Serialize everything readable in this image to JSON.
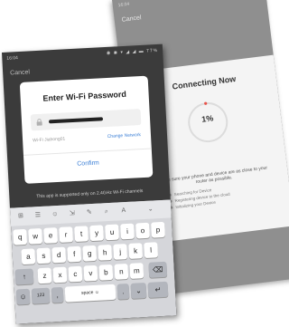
{
  "back_screen": {
    "status_time": "16:04",
    "status_icons": "◉ ◉ ▾ ◢ ◢ ▬",
    "cancel_label": "Cancel",
    "title": "Connecting Now",
    "progress_text": "1%",
    "progress_value": 1,
    "tip": "Make sure your phone and device are as close to your router as possible.",
    "steps": [
      "Searching for Device",
      "Registering device to the cloud",
      "Initializing your Device"
    ]
  },
  "front_screen": {
    "status_time": "16:04",
    "status_icons": "◉ ◉ ▾ ◢ ◢ ▬ 77%",
    "cancel_label": "Cancel",
    "dialog": {
      "title": "Enter Wi-Fi Password",
      "ssid": "Wi-Fi Jiahong01",
      "change_network": "Change Network",
      "confirm": "Confirm"
    },
    "support_note": "This app is supported only on 2.4GHz Wi-Fi channels"
  },
  "keyboard": {
    "toolbar": [
      "⊞",
      "☰",
      "☺",
      "⇲",
      "✎",
      "⌕",
      "A",
      "⌄"
    ],
    "row1": [
      "q",
      "w",
      "e",
      "r",
      "t",
      "y",
      "u",
      "i",
      "o",
      "p"
    ],
    "row2": [
      "a",
      "s",
      "d",
      "f",
      "g",
      "h",
      "j",
      "k",
      "l"
    ],
    "shift": "↑",
    "row3": [
      "z",
      "x",
      "c",
      "v",
      "b",
      "n",
      "m"
    ],
    "backspace": "⌫",
    "emoji_key": "☺",
    "num_key": "123",
    "comma": ",",
    "space": "space ☺",
    "period": ".",
    "punct": "⌄",
    "enter": "↵"
  },
  "colors": {
    "accent": "#3b7fd6",
    "progress": "#e8534a"
  }
}
